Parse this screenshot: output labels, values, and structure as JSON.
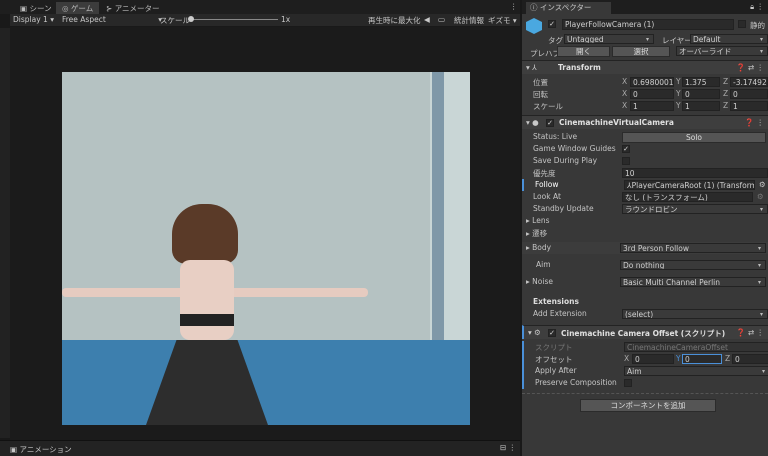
{
  "tabs": [
    {
      "label": "シーン",
      "icon": "scene-icon"
    },
    {
      "label": "ゲーム",
      "icon": "gamepad-icon"
    },
    {
      "label": "アニメーター",
      "icon": "animator-icon"
    }
  ],
  "game_toolbar": {
    "display": "Display 1",
    "aspect": "Free Aspect",
    "scale_label": "スケール",
    "scale_value": "1x",
    "maximize": "再生時に最大化",
    "stats": "統計情報",
    "gizmos": "ギズモ"
  },
  "bottom_tab": "アニメーション",
  "inspector": {
    "tab": "インスペクター",
    "object_name": "PlayerFollowCamera (1)",
    "static_label": "静的",
    "tag_label": "タグ",
    "tag": "Untagged",
    "layer_label": "レイヤー",
    "layer": "Default",
    "prefab_label": "プレハブ",
    "open": "開く",
    "select": "選択",
    "overrides": "オーバーライド",
    "transform": {
      "title": "Transform",
      "rows": [
        {
          "label": "位置",
          "x": "0.6980001",
          "y": "1.375",
          "z": "-3.174926"
        },
        {
          "label": "回転",
          "x": "0",
          "y": "0",
          "z": "0"
        },
        {
          "label": "スケール",
          "x": "1",
          "y": "1",
          "z": "1"
        }
      ]
    },
    "vcam": {
      "title": "CinemachineVirtualCamera",
      "status": "Status: Live",
      "solo": "Solo",
      "guides_label": "Game Window Guides",
      "guides": true,
      "save_label": "Save During Play",
      "save": false,
      "priority_label": "優先度",
      "priority": "10",
      "follow_label": "Follow",
      "follow": "PlayerCameraRoot (1) (Transform)",
      "lookat_label": "Look At",
      "lookat": "なし (トランスフォーム)",
      "standby_label": "Standby Update",
      "standby": "ラウンドロビン",
      "lens": "Lens",
      "transitions": "遷移",
      "body_label": "Body",
      "body": "3rd Person Follow",
      "aim_label": "Aim",
      "aim": "Do nothing",
      "noise_label": "Noise",
      "noise": "Basic Multi Channel Perlin",
      "extensions": "Extensions",
      "add_ext_label": "Add Extension",
      "add_ext": "(select)"
    },
    "offset": {
      "title": "Cinemachine Camera Offset (スクリプト)",
      "script_label": "スクリプト",
      "script": "CinemachineCameraOffset",
      "offset_label": "オフセット",
      "x": "0",
      "y": "0",
      "z": "0",
      "apply_label": "Apply After",
      "apply": "Aim",
      "preserve_label": "Preserve Composition",
      "preserve": false
    },
    "add_component": "コンポーネントを追加"
  }
}
